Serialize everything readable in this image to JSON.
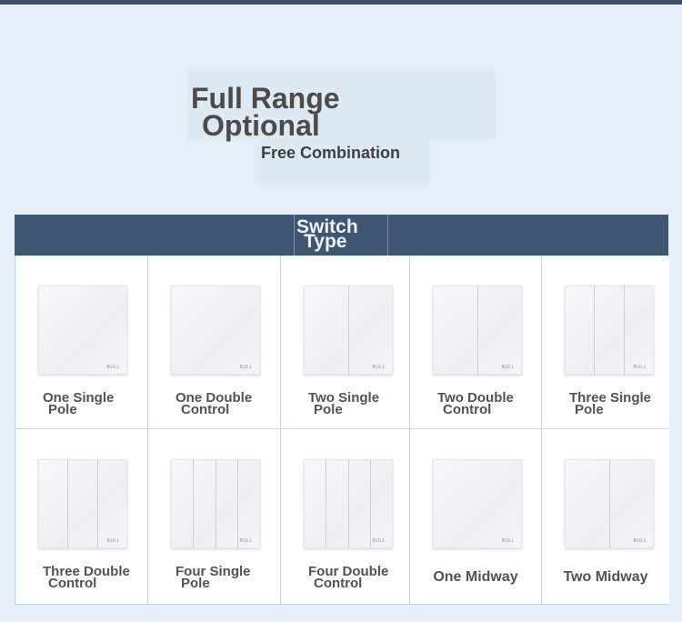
{
  "hero": {
    "title_line1": "Full Range",
    "title_line2": "Optional",
    "subtitle": "Free Combination"
  },
  "section": {
    "title_line1": "Switch",
    "title_line2": "Type"
  },
  "switches": [
    {
      "line1": "One Single",
      "line2": "Pole",
      "gangs": 1
    },
    {
      "line1": "One Double",
      "line2": "Control",
      "gangs": 1
    },
    {
      "line1": "Two Single",
      "line2": "Pole",
      "gangs": 2
    },
    {
      "line1": "Two Double",
      "line2": "Control",
      "gangs": 2
    },
    {
      "line1": "Three Single",
      "line2": "Pole",
      "gangs": 3
    },
    {
      "line1": "Three Double",
      "line2": "Control",
      "gangs": 3
    },
    {
      "line1": "Four Single",
      "line2": "Pole",
      "gangs": 4
    },
    {
      "line1": "Four Double",
      "line2": "Control",
      "gangs": 4
    },
    {
      "line1": "One Midway",
      "line2": "",
      "gangs": 1
    },
    {
      "line1": "Two Midway",
      "line2": "",
      "gangs": 2
    }
  ],
  "logo_text": "BULL",
  "colors": {
    "background": "#e3eef8",
    "banner": "#3e5670",
    "text": "#4c4a4b"
  }
}
